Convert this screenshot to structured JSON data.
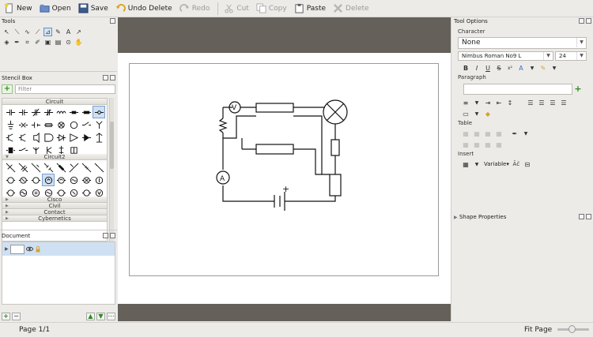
{
  "toolbar": {
    "new_label": "New",
    "open_label": "Open",
    "save_label": "Save",
    "undo_label": "Undo Delete",
    "redo_label": "Redo",
    "cut_label": "Cut",
    "copy_label": "Copy",
    "paste_label": "Paste",
    "delete_label": "Delete"
  },
  "tools_panel": {
    "title": "Tools"
  },
  "stencil_box": {
    "title": "Stencil Box",
    "filter_placeholder": "Filter",
    "categories": {
      "circuit": "Circuit",
      "circuit2": "Circuit2",
      "cisco": "Cisco",
      "civil": "Civil",
      "contact": "Contact",
      "cybernetics": "Cybernetics"
    }
  },
  "document_panel": {
    "title": "Document"
  },
  "tool_options": {
    "title": "Tool Options",
    "character_label": "Character",
    "character_style": "None",
    "font_name": "Nimbus Roman No9 L",
    "font_size": "24",
    "paragraph_label": "Paragraph",
    "table_label": "Table",
    "insert_label": "Insert",
    "variable_label": "Variable"
  },
  "shape_properties": {
    "title": "Shape Properties"
  },
  "status": {
    "page": "Page 1/1",
    "zoom": "Fit Page"
  },
  "colors": {
    "canvas_background": "#65605a",
    "accent_green": "#2e8b1e",
    "selection_blue": "#cfe0f3"
  }
}
